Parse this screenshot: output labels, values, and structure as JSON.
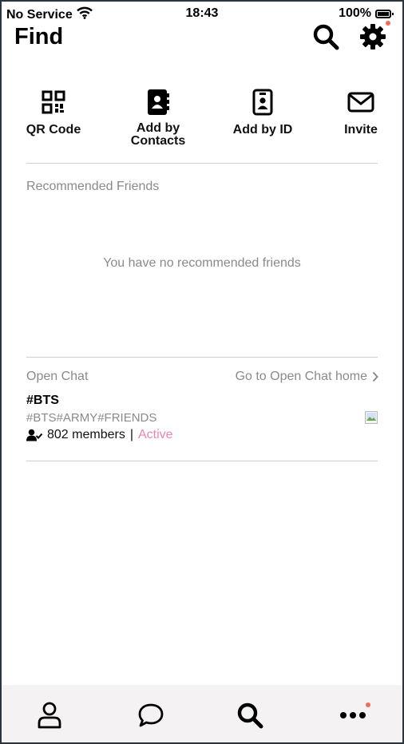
{
  "status_bar": {
    "carrier": "No Service",
    "time": "18:43",
    "battery": "100%",
    "battery_level": 1.0
  },
  "header": {
    "title": "Find",
    "icons": [
      "search-icon",
      "settings-icon"
    ]
  },
  "actions": [
    {
      "label": "QR Code",
      "icon": "qr-code-icon"
    },
    {
      "label": "Add by\nContacts",
      "icon": "contacts-book-icon"
    },
    {
      "label": "Add by ID",
      "icon": "id-card-icon"
    },
    {
      "label": "Invite",
      "icon": "envelope-icon"
    }
  ],
  "recommended": {
    "title": "Recommended Friends",
    "empty_message": "You have no recommended friends"
  },
  "open_chat": {
    "title": "Open Chat",
    "home_link": "Go to Open Chat home",
    "room": {
      "name": "#BTS",
      "tags": "#BTS#ARMY#FRIENDS",
      "members": "802 members",
      "separator": "|",
      "status": "Active"
    }
  },
  "tab_bar": {
    "tabs": [
      "friends-tab",
      "chats-tab",
      "find-tab",
      "more-tab"
    ],
    "active": "find-tab"
  },
  "colors": {
    "notification_dot": "#f26b55",
    "active_status": "#ef82b6",
    "muted_text": "#8a8a8a",
    "tab_bar_bg": "#f4f2f2"
  }
}
